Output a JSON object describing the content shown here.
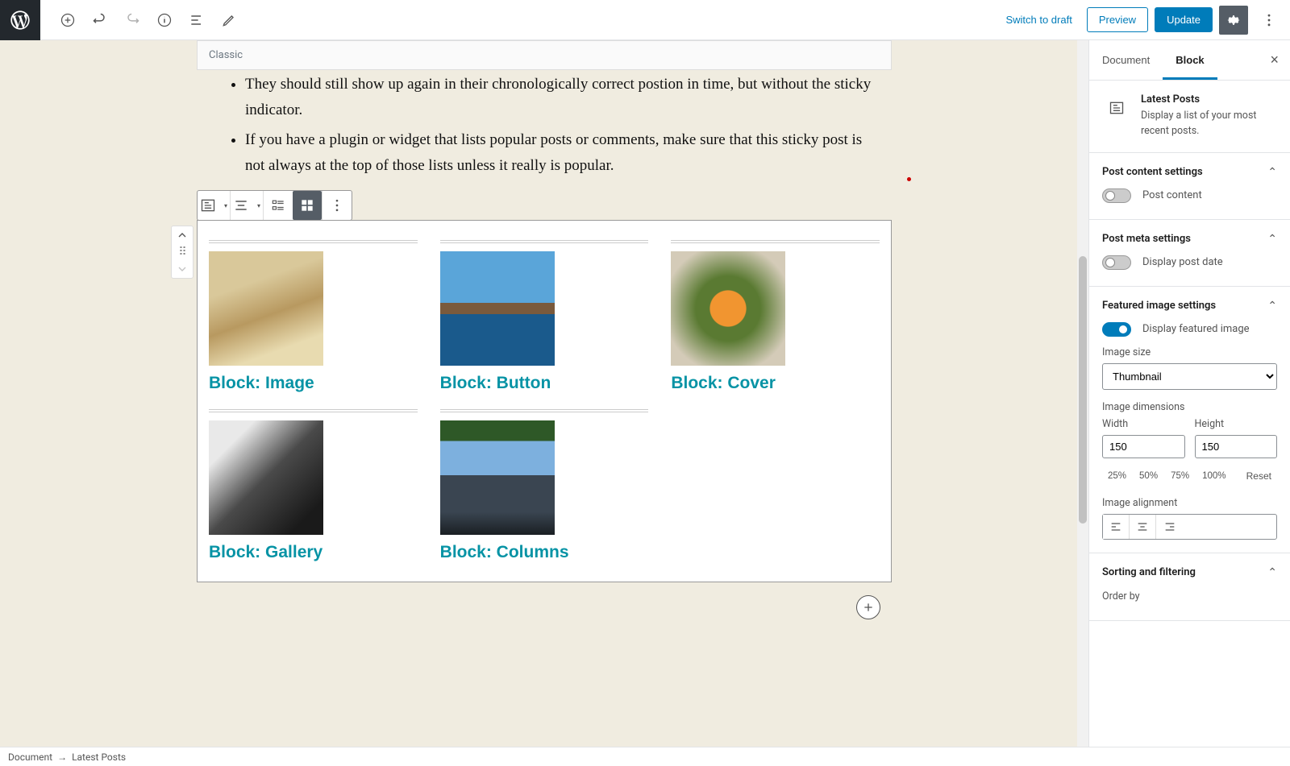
{
  "toolbar": {
    "switch_to_draft": "Switch to draft",
    "preview": "Preview",
    "update": "Update"
  },
  "classic_tab": "Classic",
  "content": {
    "bullets": [
      "They should still show up again in their chronologically correct postion in time, but without the sticky indicator.",
      "If you have a plugin or widget that lists popular posts or comments, make sure that this sticky post is not always at the top of those lists unless it really is popular."
    ]
  },
  "posts": [
    {
      "title": "Block: Image"
    },
    {
      "title": "Block: Button"
    },
    {
      "title": "Block: Cover"
    },
    {
      "title": "Block: Gallery"
    },
    {
      "title": "Block: Columns"
    }
  ],
  "sidebar_tabs": {
    "document": "Document",
    "block": "Block"
  },
  "block_summary": {
    "title": "Latest Posts",
    "desc": "Display a list of your most recent posts."
  },
  "panels": {
    "post_content": {
      "title": "Post content settings",
      "toggle_label": "Post content"
    },
    "post_meta": {
      "title": "Post meta settings",
      "toggle_label": "Display post date"
    },
    "featured_image": {
      "title": "Featured image settings",
      "toggle_label": "Display featured image",
      "image_size_label": "Image size",
      "image_size_value": "Thumbnail",
      "dimensions_label": "Image dimensions",
      "width_label": "Width",
      "height_label": "Height",
      "width_value": "150",
      "height_value": "150",
      "pct25": "25%",
      "pct50": "50%",
      "pct75": "75%",
      "pct100": "100%",
      "reset": "Reset",
      "alignment_label": "Image alignment"
    },
    "sorting": {
      "title": "Sorting and filtering",
      "order_by_label": "Order by"
    }
  },
  "footer": {
    "document": "Document",
    "block": "Latest Posts"
  }
}
